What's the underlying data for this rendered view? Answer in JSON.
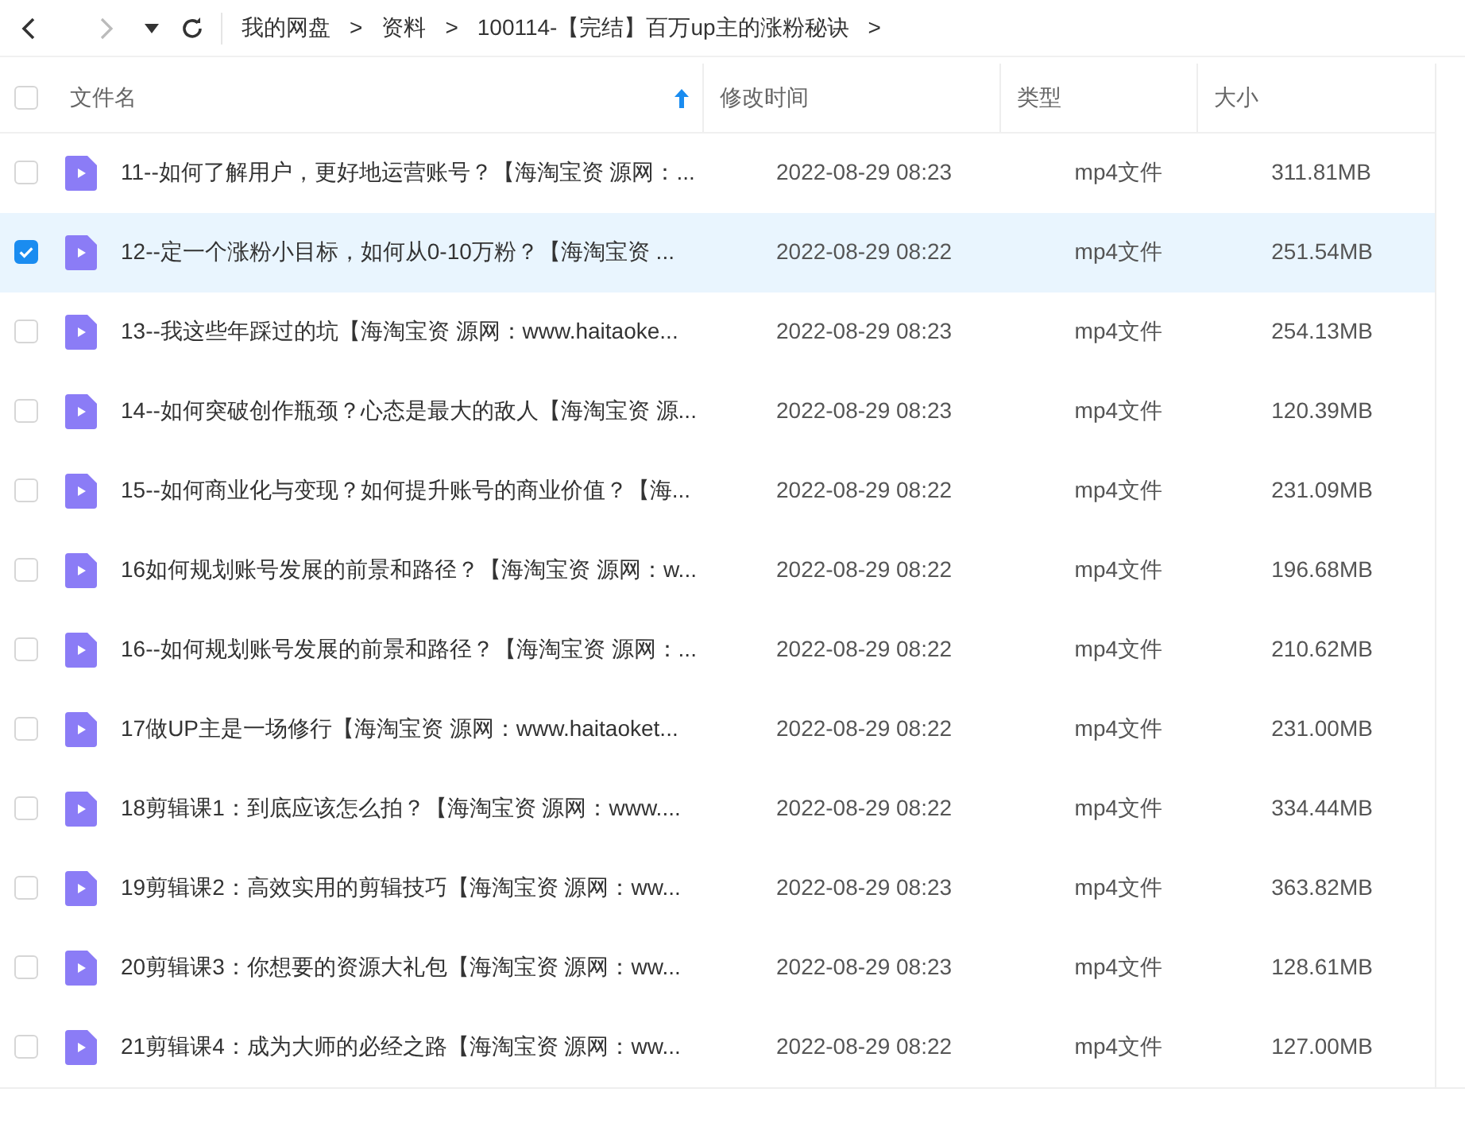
{
  "breadcrumb": [
    "我的网盘",
    "资料",
    "100114-【完结】百万up主的涨粉秘诀"
  ],
  "breadcrumb_separator": ">",
  "table": {
    "columns": [
      {
        "label": "文件名",
        "sorted": true
      },
      {
        "label": "修改时间",
        "sorted": false
      },
      {
        "label": "类型",
        "sorted": false
      },
      {
        "label": "大小",
        "sorted": false
      }
    ],
    "header_checked": false,
    "rows": [
      {
        "name": "11--如何了解用户，更好地运营账号？【海淘宝资 源网：...",
        "modified": "2022-08-29 08:23",
        "type": "mp4文件",
        "size": "311.81MB",
        "selected": false
      },
      {
        "name": "12--定一个涨粉小目标，如何从0-10万粉？【海淘宝资 ...",
        "modified": "2022-08-29 08:22",
        "type": "mp4文件",
        "size": "251.54MB",
        "selected": true
      },
      {
        "name": "13--我这些年踩过的坑【海淘宝资 源网：www.haitaoke...",
        "modified": "2022-08-29 08:23",
        "type": "mp4文件",
        "size": "254.13MB",
        "selected": false
      },
      {
        "name": "14--如何突破创作瓶颈？心态是最大的敌人【海淘宝资 源...",
        "modified": "2022-08-29 08:23",
        "type": "mp4文件",
        "size": "120.39MB",
        "selected": false
      },
      {
        "name": "15--如何商业化与变现？如何提升账号的商业价值？【海...",
        "modified": "2022-08-29 08:22",
        "type": "mp4文件",
        "size": "231.09MB",
        "selected": false
      },
      {
        "name": "16如何规划账号发展的前景和路径？【海淘宝资 源网：w...",
        "modified": "2022-08-29 08:22",
        "type": "mp4文件",
        "size": "196.68MB",
        "selected": false
      },
      {
        "name": "16--如何规划账号发展的前景和路径？【海淘宝资 源网：...",
        "modified": "2022-08-29 08:22",
        "type": "mp4文件",
        "size": "210.62MB",
        "selected": false
      },
      {
        "name": "17做UP主是一场修行【海淘宝资 源网：www.haitaoket...",
        "modified": "2022-08-29 08:22",
        "type": "mp4文件",
        "size": "231.00MB",
        "selected": false
      },
      {
        "name": "18剪辑课1：到底应该怎么拍？【海淘宝资 源网：www....",
        "modified": "2022-08-29 08:22",
        "type": "mp4文件",
        "size": "334.44MB",
        "selected": false
      },
      {
        "name": "19剪辑课2：高效实用的剪辑技巧【海淘宝资 源网：ww...",
        "modified": "2022-08-29 08:23",
        "type": "mp4文件",
        "size": "363.82MB",
        "selected": false
      },
      {
        "name": "20剪辑课3：你想要的资源大礼包【海淘宝资 源网：ww...",
        "modified": "2022-08-29 08:23",
        "type": "mp4文件",
        "size": "128.61MB",
        "selected": false
      },
      {
        "name": "21剪辑课4：成为大师的必经之路【海淘宝资 源网：ww...",
        "modified": "2022-08-29 08:22",
        "type": "mp4文件",
        "size": "127.00MB",
        "selected": false
      }
    ]
  }
}
